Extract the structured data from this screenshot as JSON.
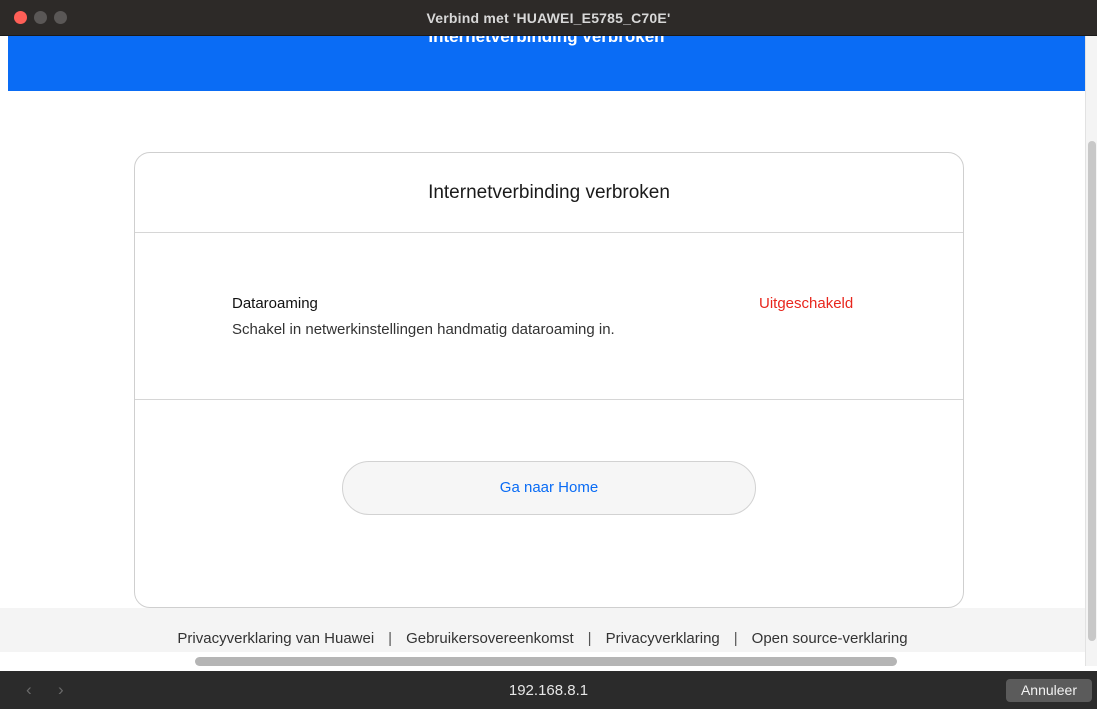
{
  "window": {
    "title": "Verbind met 'HUAWEI_E5785_C70E'"
  },
  "header": {
    "title": "Internetverbinding verbroken"
  },
  "card": {
    "title": "Internetverbinding verbroken",
    "status": {
      "name": "Dataroaming",
      "value": "Uitgeschakeld",
      "description": "Schakel in netwerkinstellingen handmatig dataroaming in."
    },
    "button_label": "Ga naar Home"
  },
  "footer": {
    "links": [
      "Privacyverklaring van Huawei",
      "Gebruikersovereenkomst",
      "Privacyverklaring",
      "Open source-verklaring"
    ],
    "separator": "|"
  },
  "bottombar": {
    "back_icon": "‹",
    "forward_icon": "›",
    "url": "192.168.8.1",
    "cancel_label": "Annuleer"
  },
  "colors": {
    "brand_blue": "#0a6cf5",
    "status_red": "#e8261d",
    "close_red": "#fe5f57"
  }
}
